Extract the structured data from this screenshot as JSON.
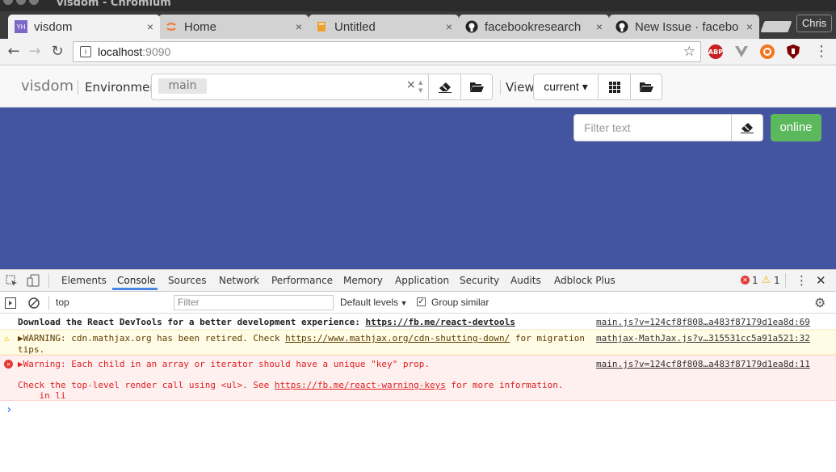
{
  "window": {
    "title": "visdom - Chromium"
  },
  "tabs": [
    {
      "label": "visdom",
      "favicon": "YH",
      "active": true
    },
    {
      "label": "Home",
      "favicon": "jupyter-icon",
      "active": false
    },
    {
      "label": "Untitled",
      "favicon": "notebook-icon",
      "active": false
    },
    {
      "label": "facebookresearch",
      "favicon": "github-icon",
      "active": false
    },
    {
      "label": "New Issue · facebo",
      "favicon": "github-icon",
      "active": false
    }
  ],
  "tab_close": "×",
  "profile": "Chris",
  "address": {
    "host": "localhost",
    "port": ":9090"
  },
  "extensions": {
    "abp": "ABP"
  },
  "visdom": {
    "brand": "visdom",
    "env_label": "Environment",
    "env_chip": "main",
    "env_clear": "×",
    "view_label": "View",
    "view_current": "current ▾",
    "filter_placeholder": "Filter text",
    "status": "online",
    "canvas_color": "#4355a0",
    "online_color": "#5cb85c"
  },
  "devtools": {
    "tabs": [
      "Elements",
      "Console",
      "Sources",
      "Network",
      "Performance",
      "Memory",
      "Application",
      "Security",
      "Audits",
      "Adblock Plus"
    ],
    "active_tab": "Console",
    "error_count": "1",
    "warning_count": "1",
    "context": "top",
    "filter_placeholder": "Filter",
    "levels": "Default levels",
    "group_similar": "Group similar",
    "messages": {
      "info": {
        "text": "Download the React DevTools for a better development experience: ",
        "link": "https://fb.me/react-devtools",
        "source": "main.js?v=124cf8f808…a483f87179d1ea8d:69"
      },
      "warning": {
        "line1_pre": "▶WARNING: cdn.mathjax.org has been retired. Check ",
        "link": "https://www.mathjax.org/cdn-shutting-down/",
        "line1_post": " for migration",
        "line2": "tips.",
        "source": "mathjax-MathJax.js?v…315531cc5a91a521:32"
      },
      "error": {
        "line1": "▶Warning: Each child in an array or iterator should have a unique \"key\" prop.",
        "line2_pre": "Check the top-level render call using <ul>. See ",
        "link": "https://fb.me/react-warning-keys",
        "line2_post": " for more information.",
        "line3": "    in li",
        "source": "main.js?v=124cf8f808…a483f87179d1ea8d:11"
      }
    },
    "prompt": "›"
  }
}
